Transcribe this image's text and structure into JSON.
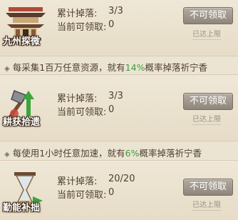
{
  "items": [
    {
      "icon_label": "九州探微",
      "cumulative_label": "累计掉落:",
      "cumulative_value": "3/3",
      "current_label": "当前可领取:",
      "current_value": "0",
      "button_label": "不可领取",
      "limit_label": "已达上限"
    },
    {
      "icon_label": "耕获拾遗",
      "cumulative_label": "累计掉落:",
      "cumulative_value": "3/3",
      "current_label": "当前可领取:",
      "current_value": "0",
      "button_label": "不可领取",
      "limit_label": "已达上限"
    },
    {
      "icon_label": "勤能补拙",
      "cumulative_label": "累计掉落:",
      "cumulative_value": "20/20",
      "current_label": "当前可领取:",
      "current_value": "0",
      "button_label": "不可领取",
      "limit_label": "已达上限"
    }
  ],
  "descriptions": [
    {
      "prefix": "每采集1百万任意资源，就有",
      "percent": "14%",
      "suffix": "概率掉落祈宁香"
    },
    {
      "prefix": "每使用1小时任意加速，就有",
      "percent": "6%",
      "suffix": "概率掉落祈宁香"
    }
  ],
  "colors": {
    "button": "#9f978c",
    "percent": "#3f9a3a",
    "background": "#ece4d3"
  }
}
